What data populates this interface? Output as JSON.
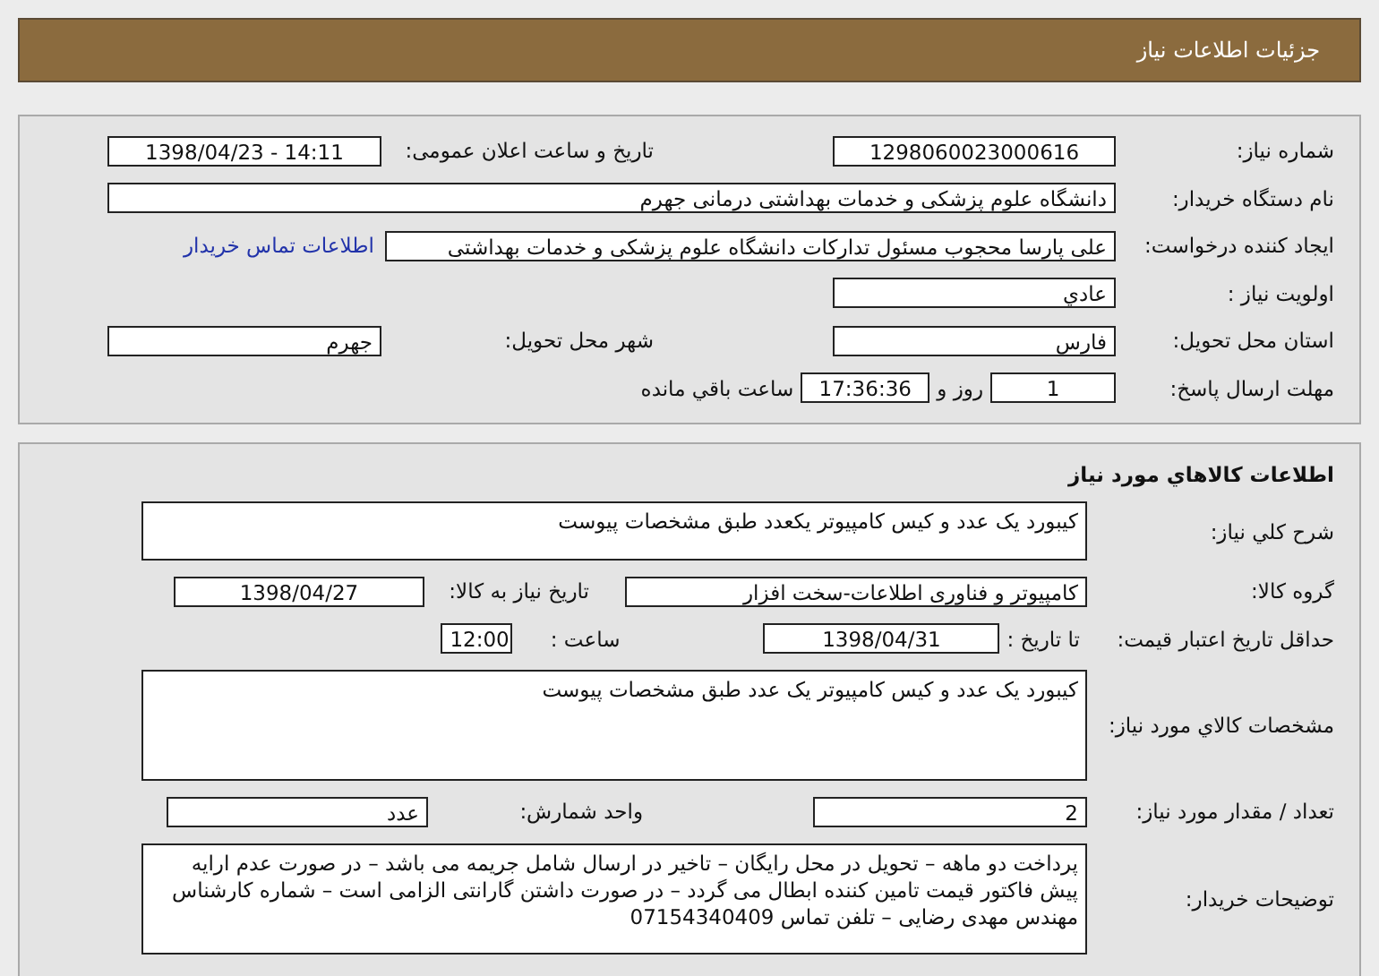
{
  "header": {
    "title": "جزئیات اطلاعات نیاز"
  },
  "request": {
    "need_number": {
      "label": "شماره نیاز:",
      "value": "1298060023000616"
    },
    "announce_datetime": {
      "label": "تاریخ و ساعت اعلان عمومی:",
      "value": "1398/04/23 - 14:11"
    },
    "buyer_org": {
      "label": "نام دستگاه خریدار:",
      "value": "دانشگاه علوم پزشکی و خدمات بهداشتی درمانی جهرم"
    },
    "requester": {
      "label": "ایجاد کننده درخواست:",
      "value": "علی پارسا محجوب مسئول تدارکات دانشگاه علوم پزشکی و خدمات بهداشتی",
      "contact_link": "اطلاعات تماس خریدار"
    },
    "priority": {
      "label": "اولویت نیاز :",
      "value": "عادي"
    },
    "province": {
      "label": "استان محل تحویل:",
      "value": "فارس"
    },
    "city": {
      "label": "شهر محل تحویل:",
      "value": "جهرم"
    },
    "deadline": {
      "label": "مهلت ارسال پاسخ:",
      "days": "1",
      "days_unit": "روز و",
      "time": "17:36:36",
      "remaining": "ساعت باقي مانده"
    }
  },
  "goods": {
    "title": "اطلاعات کالاهاي مورد نیاز",
    "summary": {
      "label": "شرح کلي نیاز:",
      "value": "کیبورد یک عدد و کیس کامپیوتر یکعدد طبق مشخصات پیوست"
    },
    "group": {
      "label": "گروه کالا:",
      "value": "کامپیوتر و فناوری اطلاعات-سخت افزار"
    },
    "need_date": {
      "label": "تاریخ نیاز به کالا:",
      "value": "1398/04/27"
    },
    "price_validity": {
      "label": "حداقل تاریخ اعتبار قیمت:",
      "date_label": "تا تاریخ :",
      "date": "1398/04/31",
      "time_label": "ساعت :",
      "time": "12:00"
    },
    "specs": {
      "label": "مشخصات کالاي مورد نیاز:",
      "value": "کیبورد یک عدد  و کیس کامپیوتر یک عدد طبق مشخصات پیوست"
    },
    "quantity": {
      "label": "تعداد / مقدار مورد نیاز:",
      "value": "2"
    },
    "unit": {
      "label": "واحد شمارش:",
      "value": "عدد"
    },
    "buyer_notes": {
      "label": "توضیحات خریدار:",
      "value": "پرداخت دو ماهه  – تحویل در محل رایگان – تاخیر در ارسال شامل جریمه می باشد – در صورت عدم ارایه پیش فاکتور قیمت تامین کننده ابطال می گردد – در صورت داشتن گارانتی الزامی است – شماره کارشناس مهندس  مهدی رضایی – تلفن تماس 07154340409"
    }
  }
}
